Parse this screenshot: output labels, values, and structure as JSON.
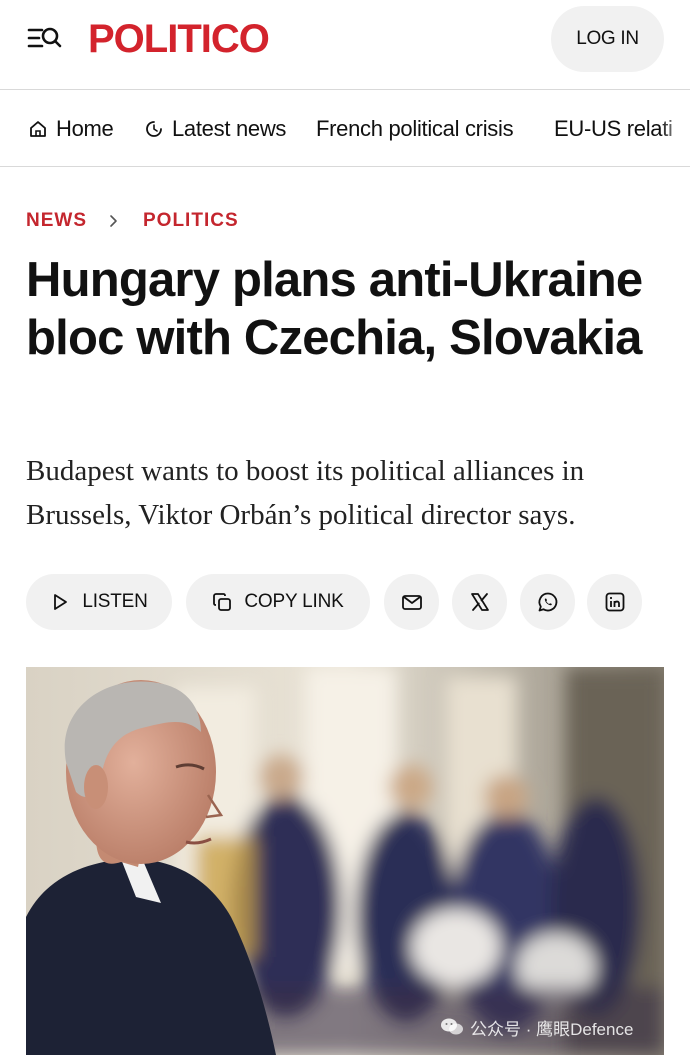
{
  "header": {
    "logo_text": "POLITICO",
    "login_label": "LOG IN",
    "menu_icon": "menu-search-icon"
  },
  "nav": {
    "items": [
      {
        "label": "Home",
        "icon": "home-icon"
      },
      {
        "label": "Latest news",
        "icon": "clock-icon"
      },
      {
        "label": "French political crisis"
      },
      {
        "label": "EU-US relati"
      }
    ]
  },
  "breadcrumb": {
    "items": [
      "NEWS",
      "POLITICS"
    ],
    "separator_icon": "chevron-right-icon"
  },
  "article": {
    "headline": "Hungary plans anti-Ukraine bloc with Czechia, Slovakia",
    "dek": "Budapest wants to boost its political alliances in Brussels, Viktor Orbán’s political director says."
  },
  "share": {
    "listen_label": "LISTEN",
    "copy_link_label": "COPY LINK",
    "icons": [
      "email-icon",
      "x-icon",
      "whatsapp-icon",
      "linkedin-icon"
    ]
  },
  "watermark": {
    "text": "公众号 · 鹰眼Defence"
  },
  "colors": {
    "brand_red": "#d3232c",
    "breadcrumb_red": "#c4262e",
    "pill_bg": "#f1f1f1",
    "text": "#111111"
  }
}
